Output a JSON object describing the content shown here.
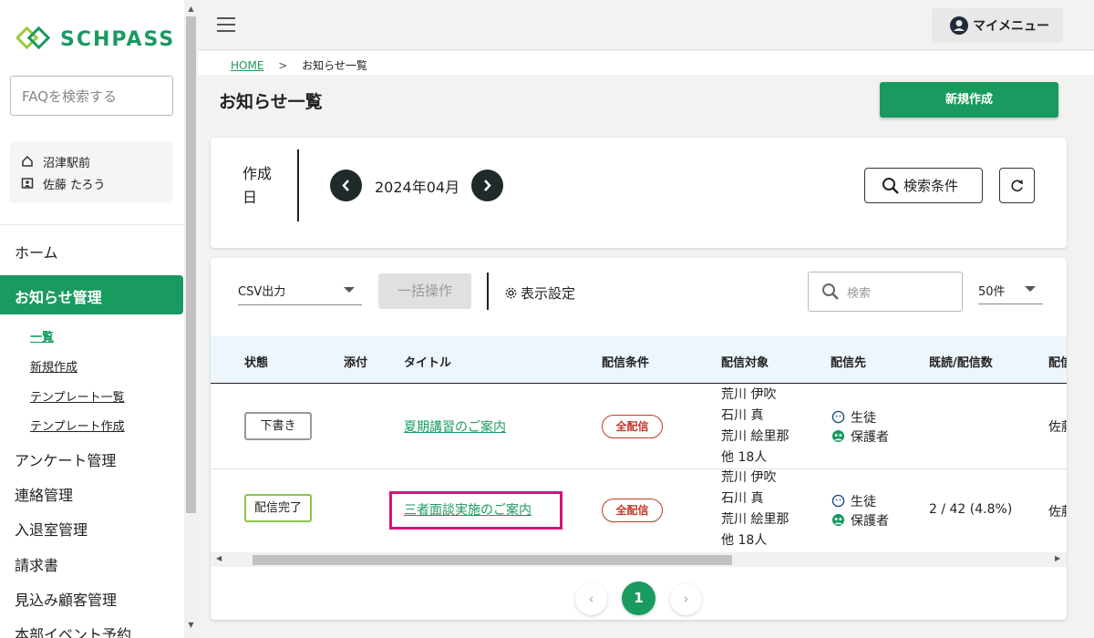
{
  "app": {
    "logo_text": "SCHPASS",
    "brand_color": "#199a5f"
  },
  "sidebar": {
    "faq_placeholder": "FAQを検索する",
    "school": "沼津駅前",
    "user": "佐藤 たろう",
    "nav": [
      {
        "label": "ホーム"
      },
      {
        "label": "お知らせ管理",
        "active": true
      },
      {
        "label": "アンケート管理"
      },
      {
        "label": "連絡管理"
      },
      {
        "label": "入退室管理"
      },
      {
        "label": "請求書"
      },
      {
        "label": "見込み顧客管理"
      },
      {
        "label": "本部イベント予約"
      }
    ],
    "sub": [
      {
        "label": "一覧",
        "active": true
      },
      {
        "label": "新規作成"
      },
      {
        "label": "テンプレート一覧"
      },
      {
        "label": "テンプレート作成"
      }
    ]
  },
  "header": {
    "mymenu_label": "マイメニュー"
  },
  "breadcrumb": {
    "home": "HOME",
    "sep": ">",
    "current": "お知らせ一覧"
  },
  "page": {
    "title": "お知らせ一覧",
    "new_button": "新規作成"
  },
  "filter": {
    "date_label": "作成日",
    "month": "2024年04月",
    "search_cond": "検索条件"
  },
  "toolbar": {
    "csv": "CSV出力",
    "bulk": "一括操作",
    "display_settings": "表示設定",
    "search_placeholder": "検索",
    "per_page": "50件"
  },
  "table": {
    "columns": [
      "状態",
      "添付",
      "タイトル",
      "配信条件",
      "配信対象",
      "配信先",
      "既読/配信数",
      "配信"
    ],
    "rows": [
      {
        "status": "下書き",
        "title": "夏期講習のご案内",
        "condition": "全配信",
        "targets": [
          "荒川 伊吹",
          "石川 真",
          "荒川 絵里那",
          "他 18人"
        ],
        "dest": [
          "生徒",
          "保護者"
        ],
        "read": "",
        "cut": "佐藤"
      },
      {
        "status": "配信完了",
        "title": "三者面談実施のご案内",
        "condition": "全配信",
        "targets": [
          "荒川 伊吹",
          "石川 真",
          "荒川 絵里那",
          "他 18人"
        ],
        "dest": [
          "生徒",
          "保護者"
        ],
        "read": "2 / 42 (4.8%)",
        "cut": "佐藤"
      }
    ]
  },
  "pagination": {
    "current": "1",
    "prev": "‹",
    "next": "›"
  }
}
